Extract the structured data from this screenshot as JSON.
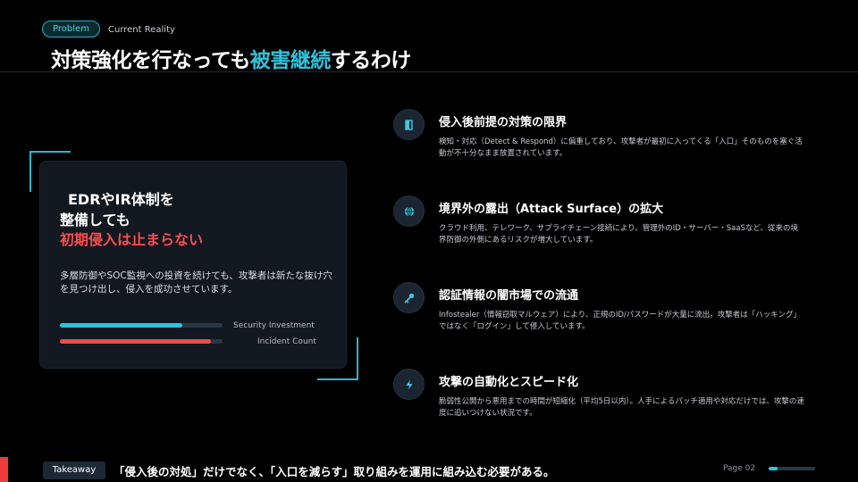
{
  "header": {
    "badge": "Problem",
    "subtitle": "Current Reality",
    "title_pre": "対策強化を行なっても",
    "title_highlight": "被害継続",
    "title_post": "するわけ"
  },
  "card": {
    "heading_line1": "EDRやIR体制を",
    "heading_line2": "整備しても",
    "heading_line3": "初期侵入は止まらない",
    "description": "多層防御やSOC監視への投資を続けても、攻撃者は新たな抜け穴を見つけ出し、侵入を成功させています。",
    "bars": [
      {
        "label": "Security Investment",
        "value": 0.75,
        "color": "#2fc2db"
      },
      {
        "label": "Incident Count",
        "value": 0.93,
        "color": "#ef4b4b"
      }
    ]
  },
  "items": [
    {
      "icon": "door-icon",
      "title": "侵入後前提の対策の限界",
      "desc": "検知・対応（Detect & Respond）に偏重しており、攻撃者が最初に入ってくる「入口」そのものを塞ぐ活動が不十分なまま放置されています。"
    },
    {
      "icon": "globe-icon",
      "title": "境界外の露出（Attack Surface）の拡大",
      "desc": "クラウド利用、テレワーク、サプライチェーン接続により、管理外のID・サーバー・SaaSなど、従来の境界防御の外側にあるリスクが増大しています。"
    },
    {
      "icon": "key-icon",
      "title": "認証情報の闇市場での流通",
      "desc": "Infostealer（情報窃取マルウェア）により、正規のID/パスワードが大量に流出。攻撃者は「ハッキング」ではなく「ログイン」して侵入しています。"
    },
    {
      "icon": "bolt-icon",
      "title": "攻撃の自動化とスピード化",
      "desc": "脆弱性公開から悪用までの時間が短縮化（平均5日以内）。人手によるパッチ適用や対応だけでは、攻撃の速度に追いつけない状況です。"
    }
  ],
  "footer": {
    "takeaway": "Takeaway",
    "message": "「侵入後の対処」だけでなく、「入口を減らす」取り組みを運用に組み込む必要がある。",
    "page": "Page 02",
    "progress": 0.2,
    "accent": "#2fc2db"
  }
}
